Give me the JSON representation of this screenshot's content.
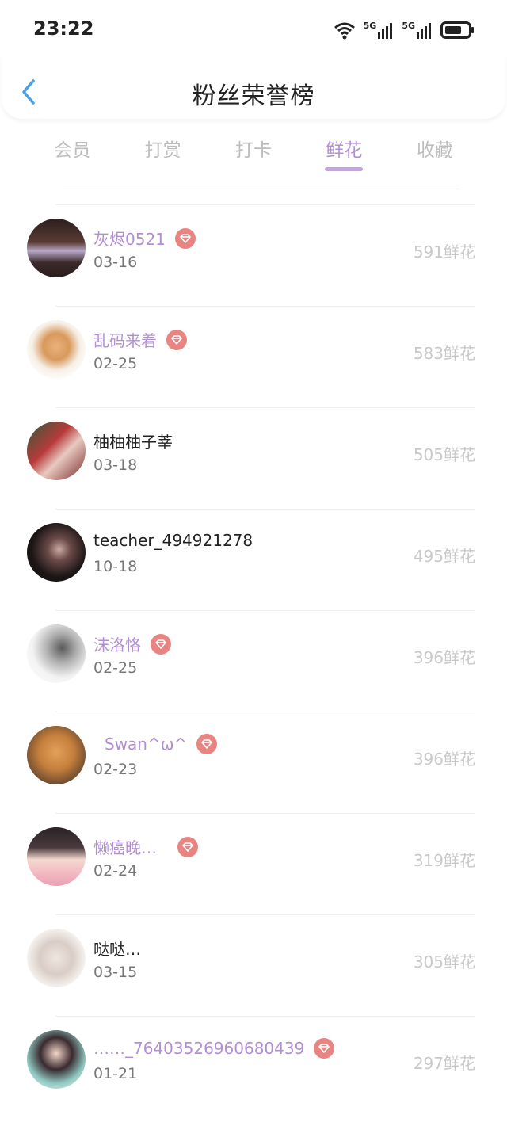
{
  "status": {
    "time": "23:22",
    "net1": "5G",
    "net2": "5G"
  },
  "header": {
    "title": "粉丝荣誉榜"
  },
  "tabs": [
    "会员",
    "打赏",
    "打卡",
    "鲜花",
    "收藏"
  ],
  "active_tab_index": 3,
  "colors": {
    "accent": "#b28fd4",
    "gem": "#e88582",
    "count": "#c9c9c9"
  },
  "fans": [
    {
      "name": "灰烬0521",
      "date": "03-16",
      "count": "591鲜花",
      "member": true
    },
    {
      "name": "乱码来着",
      "date": "02-25",
      "count": "583鲜花",
      "member": true
    },
    {
      "name": "柚柚柚子莘",
      "date": "03-18",
      "count": "505鲜花",
      "member": false
    },
    {
      "name": "teacher_494921278",
      "date": "10-18",
      "count": "495鲜花",
      "member": false
    },
    {
      "name": "沫洛恪",
      "date": "02-25",
      "count": "396鲜花",
      "member": true
    },
    {
      "name": "Swan^ω^",
      "date": "02-23",
      "count": "396鲜花",
      "member": true
    },
    {
      "name": "懒癌晚…",
      "date": "02-24",
      "count": "319鲜花",
      "member": true
    },
    {
      "name": "哒哒…",
      "date": "03-15",
      "count": "305鲜花",
      "member": false
    },
    {
      "name": "……_7640352696068043​9",
      "date": "01-21",
      "count": "297鲜花",
      "member": true
    }
  ]
}
